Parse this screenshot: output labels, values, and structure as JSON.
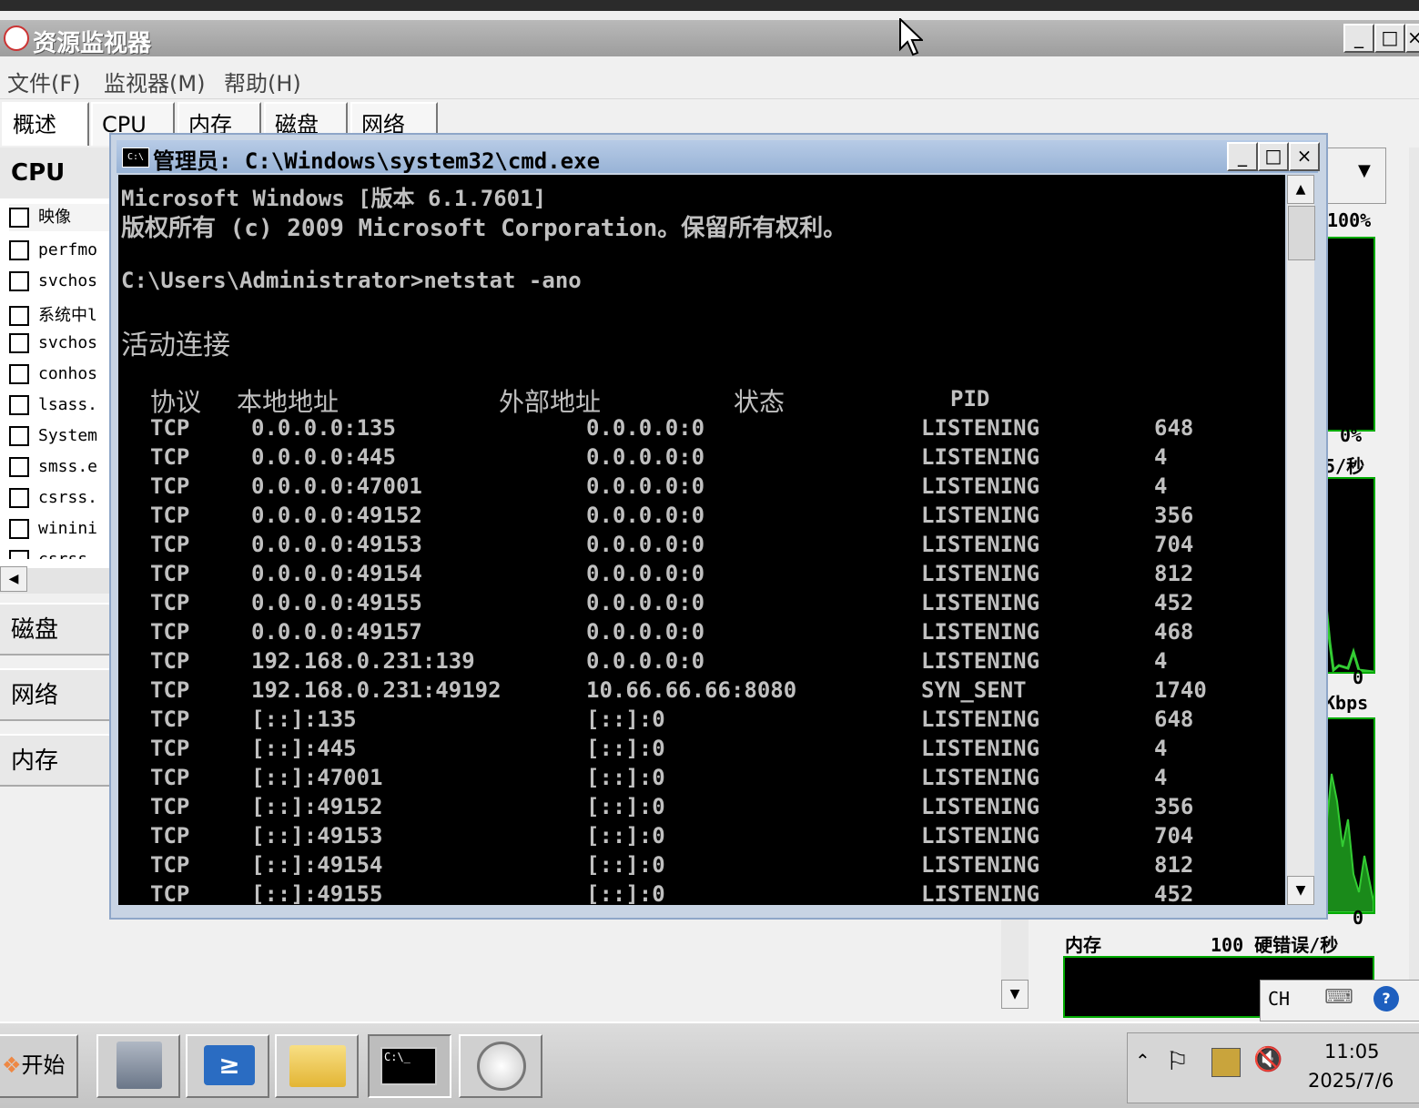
{
  "resmon": {
    "title": "资源监视器",
    "menu": [
      "文件(F)",
      "监视器(M)",
      "帮助(H)"
    ],
    "tabs": [
      "概述",
      "CPU",
      "内存",
      "磁盘",
      "网络"
    ],
    "cpu_section": "CPU",
    "image_header": "映像",
    "processes": [
      "perfmo",
      "svchos",
      "系统中l",
      "svchos",
      "conhos",
      "lsass.",
      "System",
      "smss.e",
      "csrss.",
      "winini",
      "csrss"
    ],
    "sections": [
      "磁盘",
      "网络",
      "内存"
    ],
    "graph_labels": {
      "g1_top": "100%",
      "g1_bottom": "0%",
      "g2_top": "5/秒",
      "g2_bottom": "0",
      "g3_top": "Kbps",
      "g3_bottom": "0",
      "mem_title": "内存",
      "mem_value": "100 硬错误/秒"
    },
    "lang_indicator": "CH"
  },
  "cmd": {
    "title": "管理员: C:\\Windows\\system32\\cmd.exe",
    "header1": "Microsoft Windows [版本 6.1.7601]",
    "header2": "版权所有 (c) 2009 Microsoft Corporation。保留所有权利。",
    "prompt": "C:\\Users\\Administrator>netstat -ano",
    "active": "活动连接",
    "cols": {
      "proto": "协议",
      "local": "本地地址",
      "foreign": "外部地址",
      "state": "状态",
      "pid": "PID"
    },
    "rows": [
      [
        "TCP",
        "0.0.0.0:135",
        "0.0.0.0:0",
        "LISTENING",
        "648"
      ],
      [
        "TCP",
        "0.0.0.0:445",
        "0.0.0.0:0",
        "LISTENING",
        "4"
      ],
      [
        "TCP",
        "0.0.0.0:47001",
        "0.0.0.0:0",
        "LISTENING",
        "4"
      ],
      [
        "TCP",
        "0.0.0.0:49152",
        "0.0.0.0:0",
        "LISTENING",
        "356"
      ],
      [
        "TCP",
        "0.0.0.0:49153",
        "0.0.0.0:0",
        "LISTENING",
        "704"
      ],
      [
        "TCP",
        "0.0.0.0:49154",
        "0.0.0.0:0",
        "LISTENING",
        "812"
      ],
      [
        "TCP",
        "0.0.0.0:49155",
        "0.0.0.0:0",
        "LISTENING",
        "452"
      ],
      [
        "TCP",
        "0.0.0.0:49157",
        "0.0.0.0:0",
        "LISTENING",
        "468"
      ],
      [
        "TCP",
        "192.168.0.231:139",
        "0.0.0.0:0",
        "LISTENING",
        "4"
      ],
      [
        "TCP",
        "192.168.0.231:49192",
        "10.66.66.66:8080",
        "SYN_SENT",
        "1740"
      ],
      [
        "TCP",
        "[::]:135",
        "[::]:0",
        "LISTENING",
        "648"
      ],
      [
        "TCP",
        "[::]:445",
        "[::]:0",
        "LISTENING",
        "4"
      ],
      [
        "TCP",
        "[::]:47001",
        "[::]:0",
        "LISTENING",
        "4"
      ],
      [
        "TCP",
        "[::]:49152",
        "[::]:0",
        "LISTENING",
        "356"
      ],
      [
        "TCP",
        "[::]:49153",
        "[::]:0",
        "LISTENING",
        "704"
      ],
      [
        "TCP",
        "[::]:49154",
        "[::]:0",
        "LISTENING",
        "812"
      ],
      [
        "TCP",
        "[::]:49155",
        "[::]:0",
        "LISTENING",
        "452"
      ]
    ]
  },
  "taskbar": {
    "start": "开始",
    "time": "11:05",
    "date": "2025/7/6"
  }
}
